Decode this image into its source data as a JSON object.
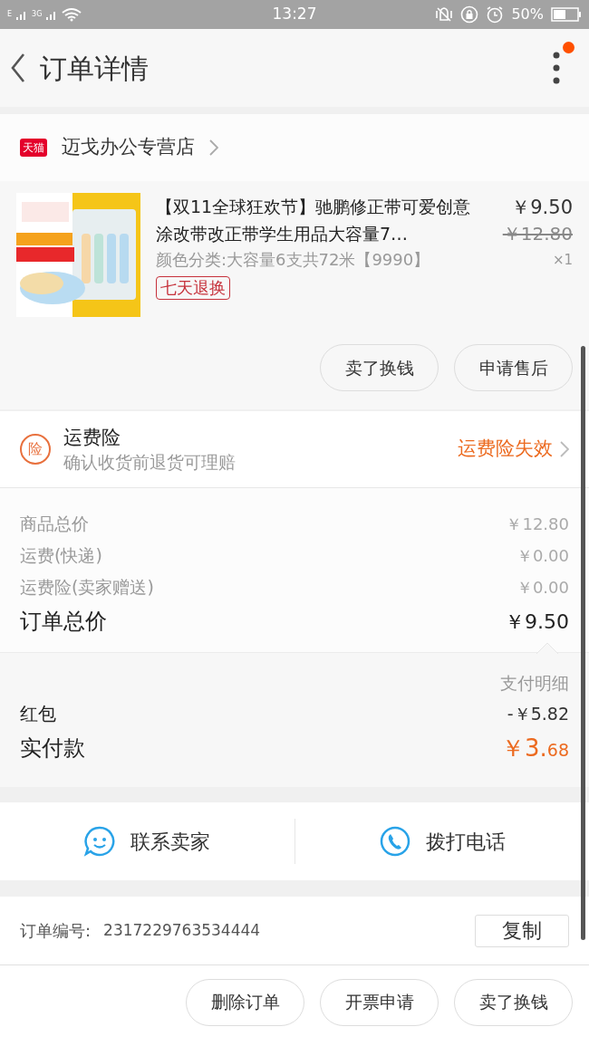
{
  "status_bar": {
    "network_1": "E",
    "network_2": "3G",
    "time": "13:27",
    "battery": "50%"
  },
  "header": {
    "title": "订单详情",
    "notification_dot": true
  },
  "store": {
    "badge": "天猫",
    "name": "迈戈办公专营店"
  },
  "product": {
    "title": "【双11全球狂欢节】驰鹏修正带可爱创意涂改带改正带学生用品大容量7…",
    "price": "￥9.50",
    "original_price": "￥12.80",
    "variant": "颜色分类:大容量6支共72米【9990】",
    "quantity": "×1",
    "tag": "七天退换",
    "buttons": [
      "卖了换钱",
      "申请售后"
    ]
  },
  "insurance": {
    "icon_char": "险",
    "title": "运费险",
    "subtitle": "确认收货前退货可理赔",
    "status": "运费险失效"
  },
  "costs": [
    {
      "label": "商品总价",
      "value": "￥12.80",
      "kind": "minor"
    },
    {
      "label": "运费(快递)",
      "value": "￥0.00",
      "kind": "minor"
    },
    {
      "label": "运费险(卖家赠送)",
      "value": "￥0.00",
      "kind": "minor"
    },
    {
      "label": "订单总价",
      "value": "￥9.50",
      "kind": "major"
    }
  ],
  "payment": {
    "title": "支付明细",
    "rows": [
      {
        "label": "红包",
        "value": "-￥5.82",
        "kind": "plain"
      },
      {
        "label": "实付款",
        "value_main": "￥3.",
        "value_cents": "68",
        "kind": "highlight"
      }
    ]
  },
  "contact": [
    {
      "label": "联系卖家",
      "kind": "chat"
    },
    {
      "label": "拨打电话",
      "kind": "phone"
    }
  ],
  "order_info": {
    "label": "订单编号:",
    "value": "2317229763534444",
    "copy_button": "复制"
  },
  "bottom_buttons": [
    "删除订单",
    "开票申请",
    "卖了换钱"
  ]
}
